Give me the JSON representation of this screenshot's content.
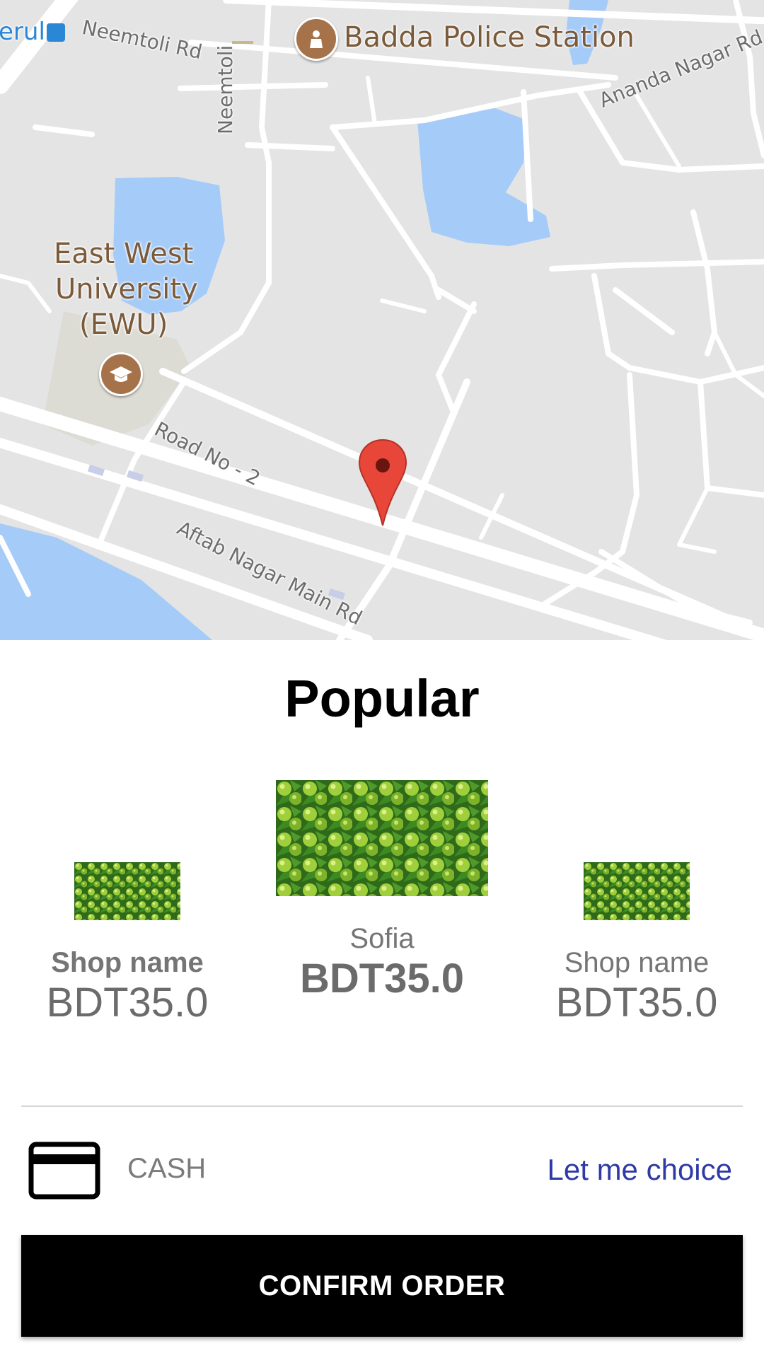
{
  "map": {
    "poi": {
      "police": "Badda Police Station",
      "university_line1": "East West",
      "university_line2": "University",
      "university_line3": "(EWU)"
    },
    "roads": {
      "neemtoli_rd": "Neemtoli Rd",
      "neemtoli": "Neemtoli",
      "ananda_nagar": "Ananda Nagar Rd",
      "road_no_2": "Road No - 2",
      "aftab_nagar": "Aftab Nagar Main Rd"
    },
    "transit_label": "erul",
    "colors": {
      "land": "#e4e4e4",
      "road": "#ffffff",
      "water": "#a5cbf9",
      "poi": "#a6724a",
      "marker": "#e9463a"
    }
  },
  "popular": {
    "title": "Popular",
    "items": [
      {
        "name": "Shop name",
        "price": "BDT35.0"
      },
      {
        "name": "Sofia",
        "price": "BDT35.0"
      },
      {
        "name": "Shop name",
        "price": "BDT35.0"
      }
    ]
  },
  "payment": {
    "icon": "credit-card-icon",
    "method": "CASH",
    "choice_link": "Let me choice"
  },
  "confirm": {
    "label": "CONFIRM ORDER"
  }
}
